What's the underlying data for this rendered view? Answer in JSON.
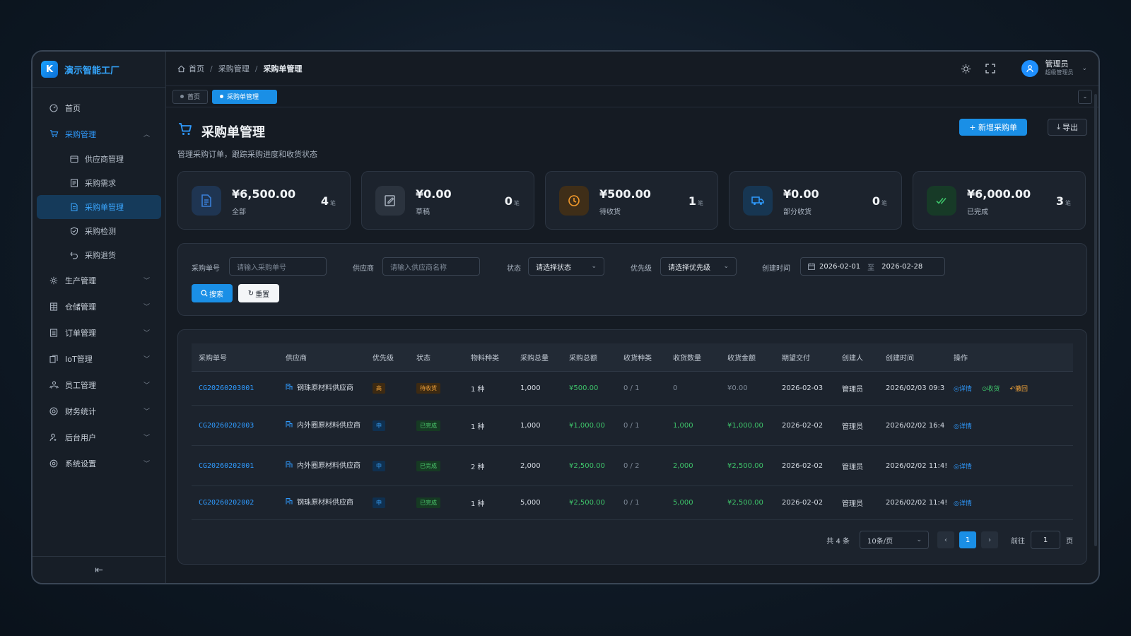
{
  "app": {
    "logo_mark": "K",
    "title": "演示智能工厂"
  },
  "sidebar": {
    "items": [
      {
        "label": "首页",
        "icon": "dashboard-icon"
      },
      {
        "label": "采购管理",
        "icon": "cart-icon",
        "open": true,
        "children": [
          {
            "label": "供应商管理",
            "icon": "store-icon"
          },
          {
            "label": "采购需求",
            "icon": "list-icon"
          },
          {
            "label": "采购单管理",
            "icon": "doc-icon",
            "active": true
          },
          {
            "label": "采购检测",
            "icon": "shield-check-icon"
          },
          {
            "label": "采购退货",
            "icon": "undo-icon"
          }
        ]
      },
      {
        "label": "生产管理",
        "icon": "gear-icon"
      },
      {
        "label": "仓储管理",
        "icon": "warehouse-icon"
      },
      {
        "label": "订单管理",
        "icon": "order-icon"
      },
      {
        "label": "IoT管理",
        "icon": "iot-icon"
      },
      {
        "label": "员工管理",
        "icon": "users-icon"
      },
      {
        "label": "财务统计",
        "icon": "finance-icon"
      },
      {
        "label": "后台用户",
        "icon": "user-admin-icon"
      },
      {
        "label": "系统设置",
        "icon": "settings-icon"
      }
    ],
    "collapse_glyph": "⇤"
  },
  "breadcrumb": {
    "home": "首页",
    "parent": "采购管理",
    "current": "采购单管理",
    "sep": "/"
  },
  "user": {
    "name": "管理员",
    "role": "超级管理员"
  },
  "tags": [
    {
      "label": "首页"
    },
    {
      "label": "采购单管理",
      "active": true
    }
  ],
  "page": {
    "title": "采购单管理",
    "desc": "管理采购订单，跟踪采购进度和收货状态",
    "new_btn": "+ 新增采购单",
    "export_btn": "导出"
  },
  "stats": [
    {
      "amount": "¥6,500.00",
      "label": "全部",
      "count": "4",
      "unit": "笔",
      "color": "#3a7fd8",
      "bg": "#1f3552",
      "icon": "doc-icon"
    },
    {
      "amount": "¥0.00",
      "label": "草稿",
      "count": "0",
      "unit": "笔",
      "color": "#a9b3bf",
      "bg": "#2b333e",
      "icon": "edit-icon"
    },
    {
      "amount": "¥500.00",
      "label": "待收货",
      "count": "1",
      "unit": "笔",
      "color": "#f39a2b",
      "bg": "#3f2e18",
      "icon": "clock-icon"
    },
    {
      "amount": "¥0.00",
      "label": "部分收货",
      "count": "0",
      "unit": "笔",
      "color": "#2f9bff",
      "bg": "#173652",
      "icon": "truck-icon"
    },
    {
      "amount": "¥6,000.00",
      "label": "已完成",
      "count": "3",
      "unit": "笔",
      "color": "#3ec46a",
      "bg": "#173a27",
      "icon": "double-check-icon"
    }
  ],
  "filters": {
    "po_label": "采购单号",
    "po_placeholder": "请输入采购单号",
    "supplier_label": "供应商",
    "supplier_placeholder": "请输入供应商名称",
    "status_label": "状态",
    "status_value": "请选择状态",
    "priority_label": "优先级",
    "priority_value": "请选择优先级",
    "created_label": "创建时间",
    "date_from": "2026-02-01",
    "date_to_sep": "至",
    "date_to": "2026-02-28",
    "search_btn": "搜索",
    "reset_btn": "重置"
  },
  "table": {
    "columns": [
      "采购单号",
      "供应商",
      "优先级",
      "状态",
      "物料种类",
      "采购总量",
      "采购总额",
      "收货种类",
      "收货数量",
      "收货金额",
      "期望交付",
      "创建人",
      "创建时间",
      "操作"
    ],
    "rows": [
      {
        "po": "CG20260203001",
        "supplier": "钢珠原材料供应商",
        "priority": "高",
        "priority_type": "high",
        "status": "待收货",
        "status_type": "wait",
        "kinds": "1 种",
        "qty": "1,000",
        "amount": "¥500.00",
        "recv_kinds": "0 / 1",
        "recv_qty": "0",
        "recv_amount": "¥0.00",
        "due": "2026-02-03",
        "creator": "管理员",
        "created": "2026/02/03 09:3",
        "actions": [
          "详情",
          "收货",
          "撤回"
        ]
      },
      {
        "po": "CG20260202003",
        "supplier": "内外圈原材料供应商",
        "priority": "中",
        "priority_type": "mid",
        "status": "已完成",
        "status_type": "done",
        "kinds": "1 种",
        "qty": "1,000",
        "amount": "¥1,000.00",
        "recv_kinds": "0 / 1",
        "recv_qty": "1,000",
        "recv_amount": "¥1,000.00",
        "due": "2026-02-02",
        "creator": "管理员",
        "created": "2026/02/02 16:4",
        "actions": [
          "详情"
        ]
      },
      {
        "po": "CG20260202001",
        "supplier": "内外圈原材料供应商",
        "priority": "中",
        "priority_type": "mid",
        "status": "已完成",
        "status_type": "done",
        "kinds": "2 种",
        "qty": "2,000",
        "amount": "¥2,500.00",
        "recv_kinds": "0 / 2",
        "recv_qty": "2,000",
        "recv_amount": "¥2,500.00",
        "due": "2026-02-02",
        "creator": "管理员",
        "created": "2026/02/02 11:4!",
        "actions": [
          "详情"
        ]
      },
      {
        "po": "CG20260202002",
        "supplier": "钢珠原材料供应商",
        "priority": "中",
        "priority_type": "mid",
        "status": "已完成",
        "status_type": "done",
        "kinds": "1 种",
        "qty": "5,000",
        "amount": "¥2,500.00",
        "recv_kinds": "0 / 1",
        "recv_qty": "5,000",
        "recv_amount": "¥2,500.00",
        "due": "2026-02-02",
        "creator": "管理员",
        "created": "2026/02/02 11:4!",
        "actions": [
          "详情"
        ]
      }
    ]
  },
  "pager": {
    "total": "共 4 条",
    "size": "10条/页",
    "prev": "‹",
    "page": "1",
    "next": "›",
    "goto": "前往",
    "goto_value": "1",
    "page_unit": "页"
  }
}
